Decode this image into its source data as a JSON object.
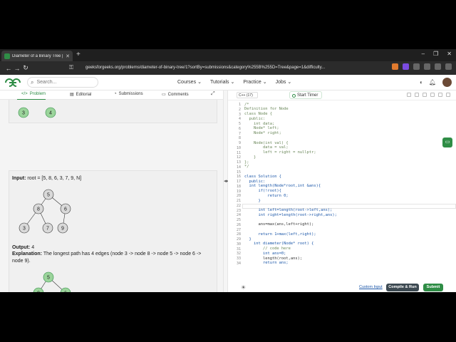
{
  "browser": {
    "tab_title": "Diameter of a Binary Tree | Prac",
    "url": "geeksforgeeks.org/problems/diameter-of-binary-tree/1?sortBy=submissions&category%255B%255D=Tree&page=1&difficulty..."
  },
  "site": {
    "search_placeholder": "Search...",
    "nav": [
      "Courses",
      "Tutorials",
      "Practice",
      "Jobs"
    ]
  },
  "left_tabs": [
    "Problem",
    "Editorial",
    "Submissions",
    "Comments"
  ],
  "top_tree_nodes": [
    "3",
    "4"
  ],
  "example2": {
    "input_label": "Input:",
    "input_value": "root = [5, 8, 6, 3, 7, 9, N]",
    "tree_nodes": [
      "5",
      "8",
      "6",
      "3",
      "7",
      "9"
    ],
    "output_label": "Output:",
    "output_value": "4",
    "explanation_label": "Explanation:",
    "explanation_text": "The longest path has 4 edges (node 3 -> node 8 -> node 5 -> node 6 -> node 9).",
    "highlight_nodes": [
      "5",
      "8",
      "6",
      "3",
      "7",
      "9"
    ]
  },
  "editor": {
    "language": "C++ (17)",
    "timer_label": "Start Timer",
    "code_lines": [
      "/*",
      "Definition for Node",
      "class Node {",
      "  public:",
      "    int data;",
      "    Node* left;",
      "    Node* right;",
      "",
      "    Node(int val) {",
      "        data = val;",
      "        left = right = nullptr;",
      "    }",
      "};",
      "*/",
      "",
      "class Solution {",
      "  public:",
      "  int length(Node*root,int &ans){",
      "      if(!root){",
      "          return 0;",
      "      }",
      "      ",
      "      int left=length(root->left,ans);",
      "      int right=length(root->right,ans);",
      "      ",
      "      ans=max(ans,left+right);",
      "      ",
      "      return 1+max(left,right);",
      "  }",
      "    int diameter(Node* root) {",
      "        // code here",
      "        int ans=0;",
      "        length(root,ans);",
      "        return ans;",
      "    }",
      "};"
    ],
    "custom_input_label": "Custom Input",
    "compile_label": "Compile & Run",
    "submit_label": "Submit"
  }
}
